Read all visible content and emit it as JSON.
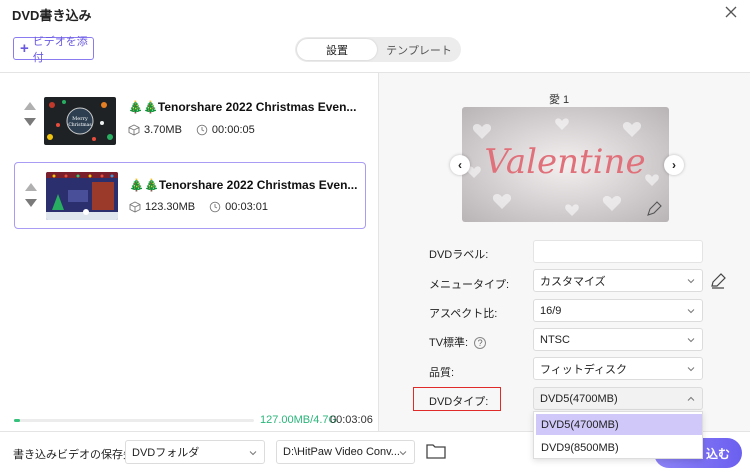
{
  "window": {
    "title": "DVD書き込み"
  },
  "toolbar": {
    "add_video_label": "ビデオを添付"
  },
  "tabs": [
    {
      "label": "設置",
      "active": true
    },
    {
      "label": "テンプレート",
      "active": false
    }
  ],
  "videos": [
    {
      "name": "🎄🎄Tenorshare 2022 Christmas Even...",
      "size": "3.70MB",
      "duration": "00:00:05",
      "selected": false
    },
    {
      "name": "🎄🎄Tenorshare 2022 Christmas Even...",
      "size": "123.30MB",
      "duration": "00:03:01",
      "selected": true
    }
  ],
  "capacity": {
    "used_text": "127.00MB/4.7G",
    "time": "00:03:06",
    "fraction": 0.027,
    "color": "#35c27c"
  },
  "menu_preview": {
    "label": "愛 1",
    "text": "Valentine"
  },
  "settings": {
    "dvd_label": {
      "label": "DVDラベル:",
      "value": ""
    },
    "menu_type": {
      "label": "メニュータイプ:",
      "value": "カスタマイズ"
    },
    "aspect": {
      "label": "アスペクト比:",
      "value": "16/9"
    },
    "tv_standard": {
      "label": "TV標準:",
      "value": "NTSC"
    },
    "quality": {
      "label": "品質:",
      "value": "フィットディスク"
    },
    "dvd_type": {
      "label": "DVDタイプ:",
      "value": "DVD5(4700MB)"
    }
  },
  "dvd_type_options": [
    {
      "label": "DVD5(4700MB)",
      "selected": true
    },
    {
      "label": "DVD9(8500MB)",
      "selected": false
    }
  ],
  "footer": {
    "save_label": "書き込みビデオの保存先:",
    "destination_type": "DVDフォルダ",
    "path": "D:\\HitPaw Video Conv...",
    "burn_label": "込む"
  },
  "colors": {
    "accent": "#6b5ff0",
    "highlight_border": "#e02a2a",
    "progress": "#35c27c"
  }
}
